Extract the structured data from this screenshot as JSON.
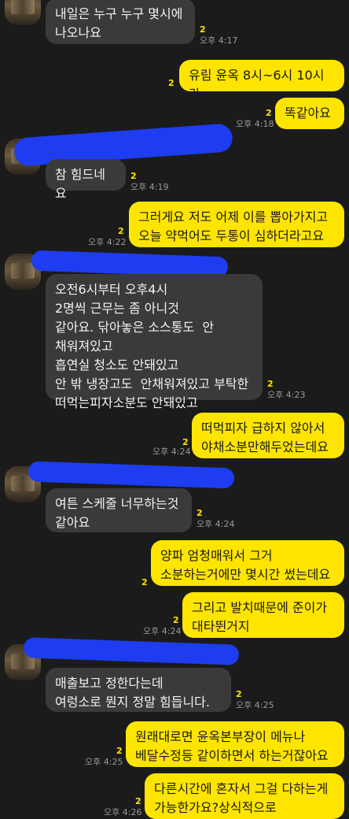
{
  "messages": [
    {
      "side": "them",
      "text": "내일은 누구 누구 몇시에\n나오나요",
      "unread": "2",
      "time": "오후 4:17"
    },
    {
      "side": "me",
      "text": "유림 윤옥 8시~6시 10시간",
      "unread": "2",
      "time": ""
    },
    {
      "side": "me",
      "text": "똑같아요",
      "unread": "2",
      "time": "오후 4:18"
    },
    {
      "side": "them",
      "text": "참 힘드네요",
      "unread": "2",
      "time": "오후 4:19"
    },
    {
      "side": "me",
      "text": "그러게요 저도 어제 이를 뽑아가지고\n오늘 약먹어도 두통이 심하더라고요",
      "unread": "2",
      "time": "오후 4:22"
    },
    {
      "side": "them",
      "text": "오전6시부터 오후4시\n2명씩 근무는 좀 아니것\n같아요. 닦아놓은 소스통도  안\n채워져있고\n흡연실 청소도 안돼있고\n안 밖 냉장고도  안채워져있고 부탁한\n떠먹는피자소분도 안돼있고",
      "unread": "2",
      "time": "오후 4:23"
    },
    {
      "side": "me",
      "text": "떠먹피자 급하지 않아서\n야채소분만해두었는데요",
      "unread": "2",
      "time": "오후 4:24"
    },
    {
      "side": "them",
      "text": "여튼 스케줄 너무하는것\n같아요",
      "unread": "2",
      "time": "오후 4:24"
    },
    {
      "side": "me",
      "text": "양파 엄청매워서 그거\n소분하는거에만 몇시간 썼는데요",
      "unread": "2",
      "time": ""
    },
    {
      "side": "me",
      "text": "그리고 발치때문에 준이가\n대타뛴거지",
      "unread": "2",
      "time": "오후 4:24"
    },
    {
      "side": "them",
      "text": "매출보고 정한다는데\n여렁소로   뭔지  정말 힘듭니다.",
      "unread": "2",
      "time": "오후 4:25"
    },
    {
      "side": "me",
      "text": "원래대로면 윤옥본부장이 메뉴나\n베달수정등 같이하면서 하는거잖아요",
      "unread": "2",
      "time": "오후 4:25"
    },
    {
      "side": "me",
      "text": "다른시간에 혼자서 그걸 다하는게\n가능한가요?상식적으로",
      "unread": "2",
      "time": "오후 4:26"
    }
  ]
}
